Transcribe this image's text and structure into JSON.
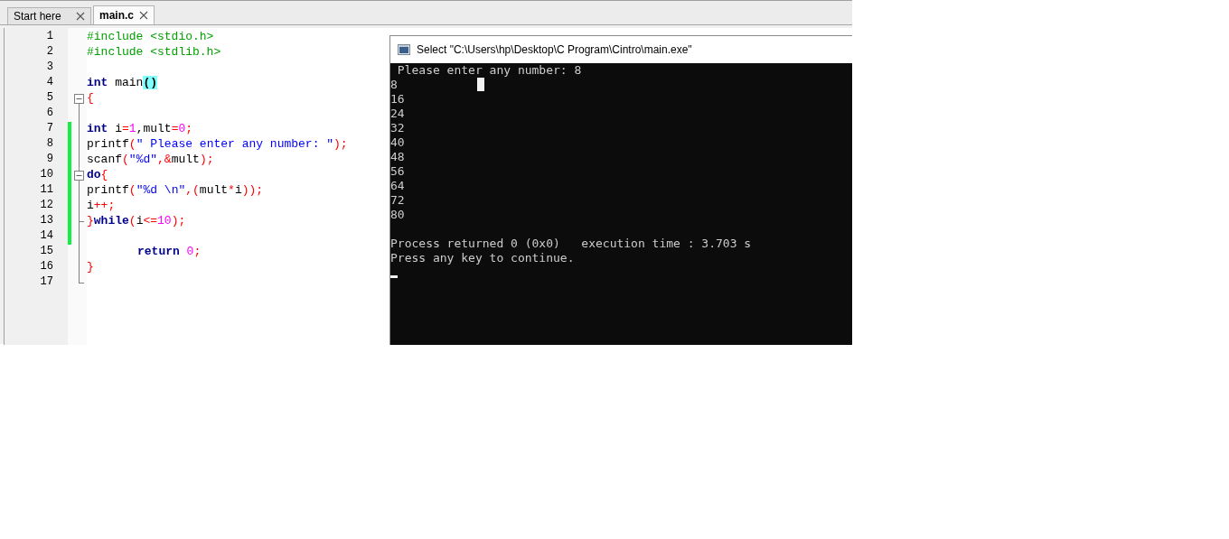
{
  "tabs": [
    {
      "label": "Start here",
      "selected": false
    },
    {
      "label": "main.c",
      "selected": true
    }
  ],
  "editor": {
    "lines": [
      {
        "number": "1",
        "modified": false,
        "fold_start": false,
        "fold_end": false,
        "tokens": [
          {
            "kind": "preprocessor",
            "text": "#include <stdio.h>"
          }
        ]
      },
      {
        "number": "2",
        "modified": false,
        "fold_start": false,
        "fold_end": false,
        "tokens": [
          {
            "kind": "preprocessor",
            "text": "#include <stdlib.h>"
          }
        ]
      },
      {
        "number": "3",
        "modified": false,
        "fold_start": false,
        "fold_end": false
      },
      {
        "number": "4",
        "modified": false,
        "fold_start": false,
        "fold_end": false,
        "tokens": [
          {
            "kind": "keyword",
            "text": "int"
          },
          {
            "kind": "plain",
            "text": " main"
          },
          {
            "kind": "brace_match",
            "text": "()"
          }
        ]
      },
      {
        "number": "5",
        "modified": false,
        "fold_start": true,
        "fold_end": false,
        "tokens": [
          {
            "kind": "operator",
            "text": "{"
          }
        ]
      },
      {
        "number": "6",
        "modified": false,
        "fold_start": false,
        "fold_end": false
      },
      {
        "number": "7",
        "modified": true,
        "fold_start": false,
        "fold_end": false,
        "tokens": [
          {
            "kind": "keyword",
            "text": "int"
          },
          {
            "kind": "plain",
            "text": " i"
          },
          {
            "kind": "operator",
            "text": "="
          },
          {
            "kind": "number",
            "text": "1"
          },
          {
            "kind": "plain",
            "text": ",mult"
          },
          {
            "kind": "operator",
            "text": "="
          },
          {
            "kind": "number",
            "text": "0"
          },
          {
            "kind": "operator",
            "text": ";"
          }
        ]
      },
      {
        "number": "8",
        "modified": true,
        "fold_start": false,
        "fold_end": false,
        "tokens": [
          {
            "kind": "plain",
            "text": "printf"
          },
          {
            "kind": "operator",
            "text": "("
          },
          {
            "kind": "string",
            "text": "\" Please enter any number: \""
          },
          {
            "kind": "operator",
            "text": ");"
          }
        ]
      },
      {
        "number": "9",
        "modified": true,
        "fold_start": false,
        "fold_end": false,
        "tokens": [
          {
            "kind": "plain",
            "text": "scanf"
          },
          {
            "kind": "operator",
            "text": "("
          },
          {
            "kind": "string",
            "text": "\"%d\""
          },
          {
            "kind": "operator",
            "text": ",&"
          },
          {
            "kind": "plain",
            "text": "mult"
          },
          {
            "kind": "operator",
            "text": ");"
          }
        ]
      },
      {
        "number": "10",
        "modified": true,
        "fold_start": true,
        "fold_end": false,
        "tokens": [
          {
            "kind": "keyword",
            "text": "do"
          },
          {
            "kind": "operator",
            "text": "{"
          }
        ]
      },
      {
        "number": "11",
        "modified": true,
        "fold_start": false,
        "fold_end": false,
        "tokens": [
          {
            "kind": "plain",
            "text": "printf"
          },
          {
            "kind": "operator",
            "text": "("
          },
          {
            "kind": "string",
            "text": "\"%d \\n\""
          },
          {
            "kind": "operator",
            "text": ",("
          },
          {
            "kind": "plain",
            "text": "mult"
          },
          {
            "kind": "operator",
            "text": "*"
          },
          {
            "kind": "plain",
            "text": "i"
          },
          {
            "kind": "operator",
            "text": "));"
          }
        ]
      },
      {
        "number": "12",
        "modified": true,
        "fold_start": false,
        "fold_end": false,
        "tokens": [
          {
            "kind": "plain",
            "text": "i"
          },
          {
            "kind": "operator",
            "text": "++;"
          }
        ]
      },
      {
        "number": "13",
        "modified": true,
        "fold_start": false,
        "fold_end": true,
        "tokens": [
          {
            "kind": "operator",
            "text": "}"
          },
          {
            "kind": "keyword",
            "text": "while"
          },
          {
            "kind": "operator",
            "text": "("
          },
          {
            "kind": "plain",
            "text": "i"
          },
          {
            "kind": "operator",
            "text": "<="
          },
          {
            "kind": "number",
            "text": "10"
          },
          {
            "kind": "operator",
            "text": ");"
          }
        ]
      },
      {
        "number": "14",
        "modified": true,
        "fold_start": false,
        "fold_end": false
      },
      {
        "number": "15",
        "modified": false,
        "fold_start": false,
        "fold_end": false,
        "indented": true,
        "tokens": [
          {
            "kind": "keyword",
            "text": "return"
          },
          {
            "kind": "number",
            "text": "0",
            "space_before": true
          },
          {
            "kind": "operator",
            "text": ";"
          }
        ]
      },
      {
        "number": "16",
        "modified": false,
        "fold_start": false,
        "fold_end": false,
        "tokens": [
          {
            "kind": "operator",
            "text": "}"
          }
        ]
      },
      {
        "number": "17",
        "modified": false,
        "fold_start": false,
        "fold_end": true
      }
    ]
  },
  "console": {
    "title": "Select \"C:\\Users\\hp\\Desktop\\C Program\\Cintro\\main.exe\"",
    "output": [
      " Please enter any number: 8",
      "8",
      "16",
      "24",
      "32",
      "40",
      "48",
      "56",
      "64",
      "72",
      "80"
    ],
    "status": [
      "Process returned 0 (0x0)   execution time : 3.703 s",
      "Press any key to continue."
    ]
  }
}
